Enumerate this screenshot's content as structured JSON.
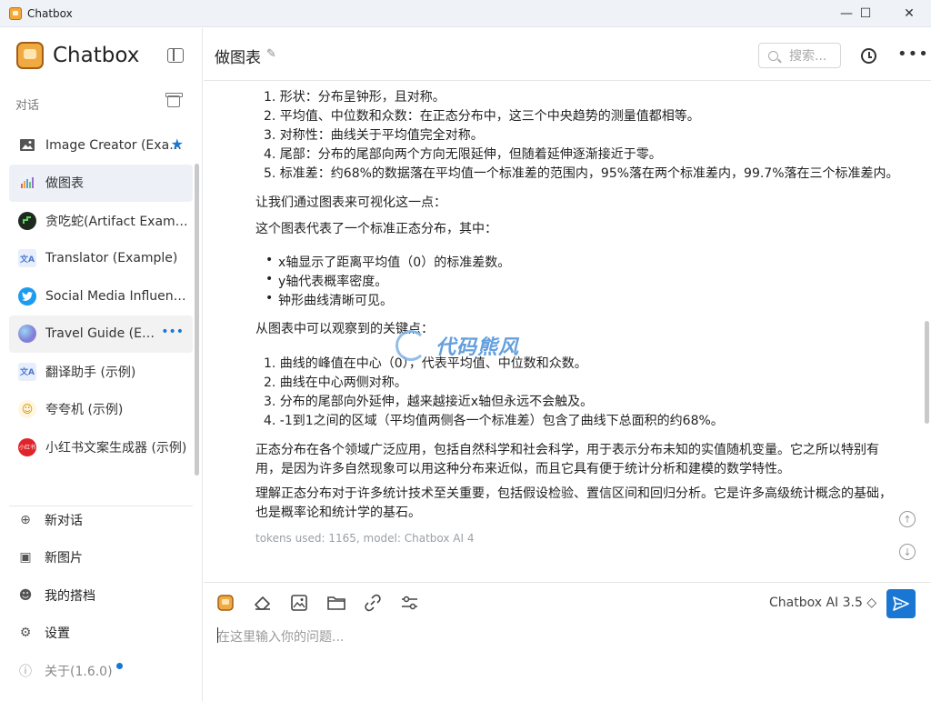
{
  "window": {
    "title": "Chatbox",
    "minimize": "—",
    "maximize": "☐",
    "close": "✕"
  },
  "sidebar": {
    "brand": "Chatbox",
    "section_label": "对话",
    "conversations": [
      {
        "label": "Image Creator (Example)",
        "icon": "image-icon",
        "color": "#555555",
        "starred": true
      },
      {
        "label": "做图表",
        "icon": "chart-icon",
        "color": "#e8eef7",
        "active": true
      },
      {
        "label": "贪吃蛇(Artifact Example)",
        "icon": "snake-game-icon",
        "color": "#1f2a1f"
      },
      {
        "label": "Translator (Example)",
        "icon": "translate-icon",
        "color": "#4a7bd0"
      },
      {
        "label": "Social Media Influencer (Example)",
        "icon": "twitter-icon",
        "color": "#1d9bf0"
      },
      {
        "label": "Travel Guide (Example)",
        "icon": "globe-icon",
        "color": "#8a8fd6",
        "hover": true
      },
      {
        "label": "翻译助手 (示例)",
        "icon": "translate-icon",
        "color": "#4a7bd0"
      },
      {
        "label": "夸夸机 (示例)",
        "icon": "praise-bot-icon",
        "color": "#f0c040"
      },
      {
        "label": "小红书文案生成器 (示例)",
        "icon": "xiaohongshu-icon",
        "color": "#e0242b",
        "badge": "小红书"
      }
    ],
    "menu": [
      {
        "label": "新对话",
        "icon": "plus-circle-icon",
        "glyph": "⊕"
      },
      {
        "label": "新图片",
        "icon": "new-image-icon",
        "glyph": "▣"
      },
      {
        "label": "我的搭档",
        "icon": "robot-icon",
        "glyph": "☻"
      },
      {
        "label": "设置",
        "icon": "gear-icon",
        "glyph": "⚙"
      },
      {
        "label": "关于(1.6.0)",
        "icon": "info-icon",
        "glyph": "ⓘ",
        "muted": true
      }
    ]
  },
  "header": {
    "title": "做图表",
    "search_placeholder": "搜索..."
  },
  "message": {
    "list1": [
      "1. 形状：分布呈钟形，且对称。",
      "2. 平均值、中位数和众数：在正态分布中，这三个中央趋势的测量值都相等。",
      "3. 对称性：曲线关于平均值完全对称。",
      "4. 尾部：分布的尾部向两个方向无限延伸，但随着延伸逐渐接近于零。",
      "5. 标准差：约68%的数据落在平均值一个标准差的范围内，95%落在两个标准差内，99.7%落在三个标准差内。"
    ],
    "para1": "让我们通过图表来可视化这一点：",
    "para2": "这个图表代表了一个标准正态分布，其中：",
    "bullets": [
      "x轴显示了距离平均值（0）的标准差数。",
      "y轴代表概率密度。",
      "钟形曲线清晰可见。"
    ],
    "para3": "从图表中可以观察到的关键点：",
    "list2": [
      "1. 曲线的峰值在中心（0），代表平均值、中位数和众数。",
      "2. 曲线在中心两侧对称。",
      "3. 分布的尾部向外延伸，越来越接近x轴但永远不会触及。",
      "4. -1到1之间的区域（平均值两侧各一个标准差）包含了曲线下总面积的约68%。"
    ],
    "para4": "正态分布在各个领域广泛应用，包括自然科学和社会科学，用于表示分布未知的实值随机变量。它之所以特别有用，是因为许多自然现象可以用这种分布来近似，而且它具有便于统计分析和建模的数学特性。",
    "para5": "理解正态分布对于许多统计技术至关重要，包括假设检验、置信区间和回归分析。它是许多高级统计概念的基础，也是概率论和统计学的基石。",
    "meta": "tokens used: 1165, model: Chatbox AI 4"
  },
  "watermark": {
    "text": "代码熊风"
  },
  "composer": {
    "model": "Chatbox AI 3.5 ◇",
    "placeholder": "在这里输入你的问题...",
    "send_icon": "send-icon"
  },
  "colors": {
    "accent": "#1976d2",
    "active_bg": "#edf1f7"
  }
}
